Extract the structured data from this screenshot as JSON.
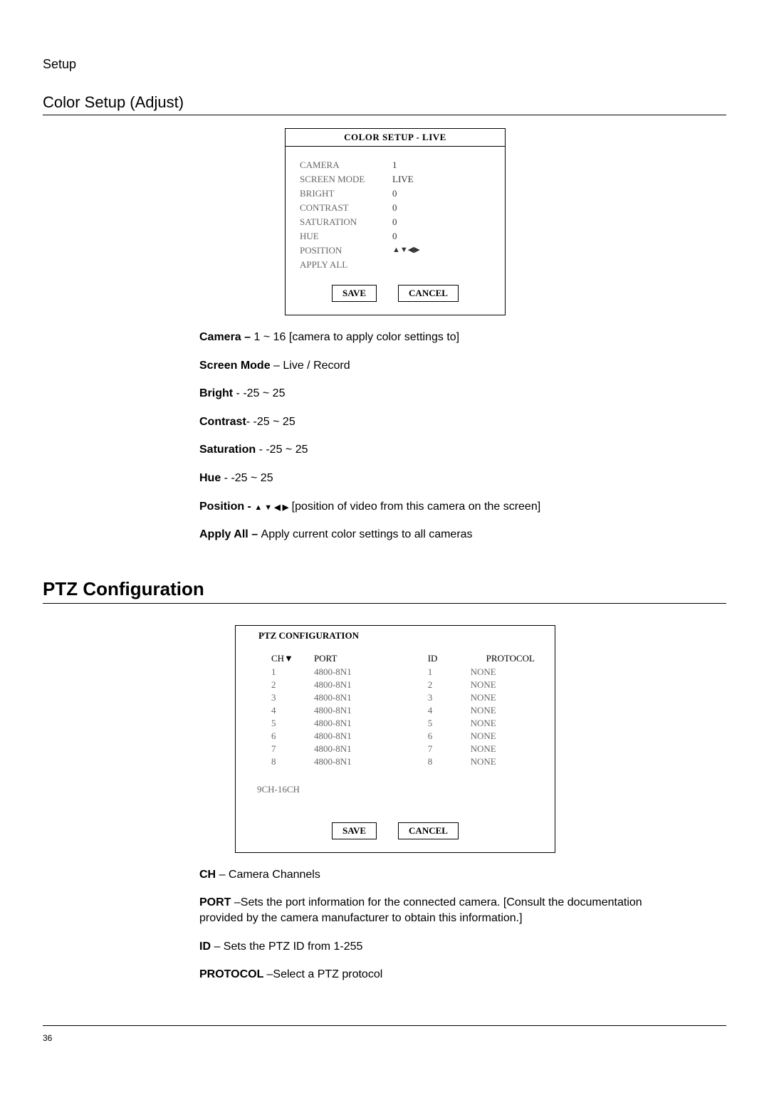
{
  "header": "Setup",
  "section1": {
    "title": "Color Setup (Adjust)",
    "dialog": {
      "title": "COLOR SETUP - LIVE",
      "rows": [
        {
          "label": "CAMERA",
          "value": "1"
        },
        {
          "label": "SCREEN MODE",
          "value": "LIVE"
        },
        {
          "label": "BRIGHT",
          "value": "0"
        },
        {
          "label": "CONTRAST",
          "value": "0"
        },
        {
          "label": "SATURATION",
          "value": "0"
        },
        {
          "label": "HUE",
          "value": "0"
        },
        {
          "label": "POSITION",
          "value": "▲▼◀▶"
        },
        {
          "label": "APPLY ALL",
          "value": ""
        }
      ],
      "save": "SAVE",
      "cancel": "CANCEL"
    },
    "lines": {
      "camera": {
        "b": "Camera – ",
        "t": "1 ~ 16 [camera to apply color settings to]"
      },
      "screen": {
        "b": "Screen Mode ",
        "t": "– Live / Record"
      },
      "bright": {
        "b": "Bright ",
        "t": "- -25 ~ 25"
      },
      "contrast": {
        "b": "Contrast",
        "t": "- -25 ~ 25"
      },
      "saturation": {
        "b": "Saturation ",
        "t": "- -25 ~ 25"
      },
      "hue": {
        "b": "Hue ",
        "t": "- -25 ~ 25"
      },
      "position": {
        "b": "Position - ",
        "arrows": "▲  ▼  ◀  ▶",
        "t": "  [position of video from this camera on the screen]"
      },
      "apply": {
        "b": "Apply All – ",
        "t": "Apply current color settings to all cameras"
      }
    }
  },
  "section2": {
    "title": "PTZ Configuration",
    "dialog": {
      "title": "PTZ CONFIGURATION",
      "headers": {
        "ch": "CH▼",
        "port": "PORT",
        "id": "ID",
        "protocol": "PROTOCOL"
      },
      "rows": [
        {
          "ch": "1",
          "port": "4800-8N1",
          "id": "1",
          "protocol": "NONE"
        },
        {
          "ch": "2",
          "port": "4800-8N1",
          "id": "2",
          "protocol": "NONE"
        },
        {
          "ch": "3",
          "port": "4800-8N1",
          "id": "3",
          "protocol": "NONE"
        },
        {
          "ch": "4",
          "port": "4800-8N1",
          "id": "4",
          "protocol": "NONE"
        },
        {
          "ch": "5",
          "port": "4800-8N1",
          "id": "5",
          "protocol": "NONE"
        },
        {
          "ch": "6",
          "port": "4800-8N1",
          "id": "6",
          "protocol": "NONE"
        },
        {
          "ch": "7",
          "port": "4800-8N1",
          "id": "7",
          "protocol": "NONE"
        },
        {
          "ch": "8",
          "port": "4800-8N1",
          "id": "8",
          "protocol": "NONE"
        }
      ],
      "subrange": "9CH-16CH",
      "save": "SAVE",
      "cancel": "CANCEL"
    },
    "lines": {
      "ch": {
        "b": "CH ",
        "t": "– Camera Channels"
      },
      "port": {
        "b": "PORT ",
        "t": "–Sets the port information for the connected camera. [Consult the documentation provided by the camera manufacturer to obtain this information.]"
      },
      "id": {
        "b": "ID ",
        "t": "– Sets the PTZ ID from 1-255"
      },
      "protocol": {
        "b": "PROTOCOL ",
        "t": "–Select a PTZ protocol"
      }
    }
  },
  "page_number": "36"
}
